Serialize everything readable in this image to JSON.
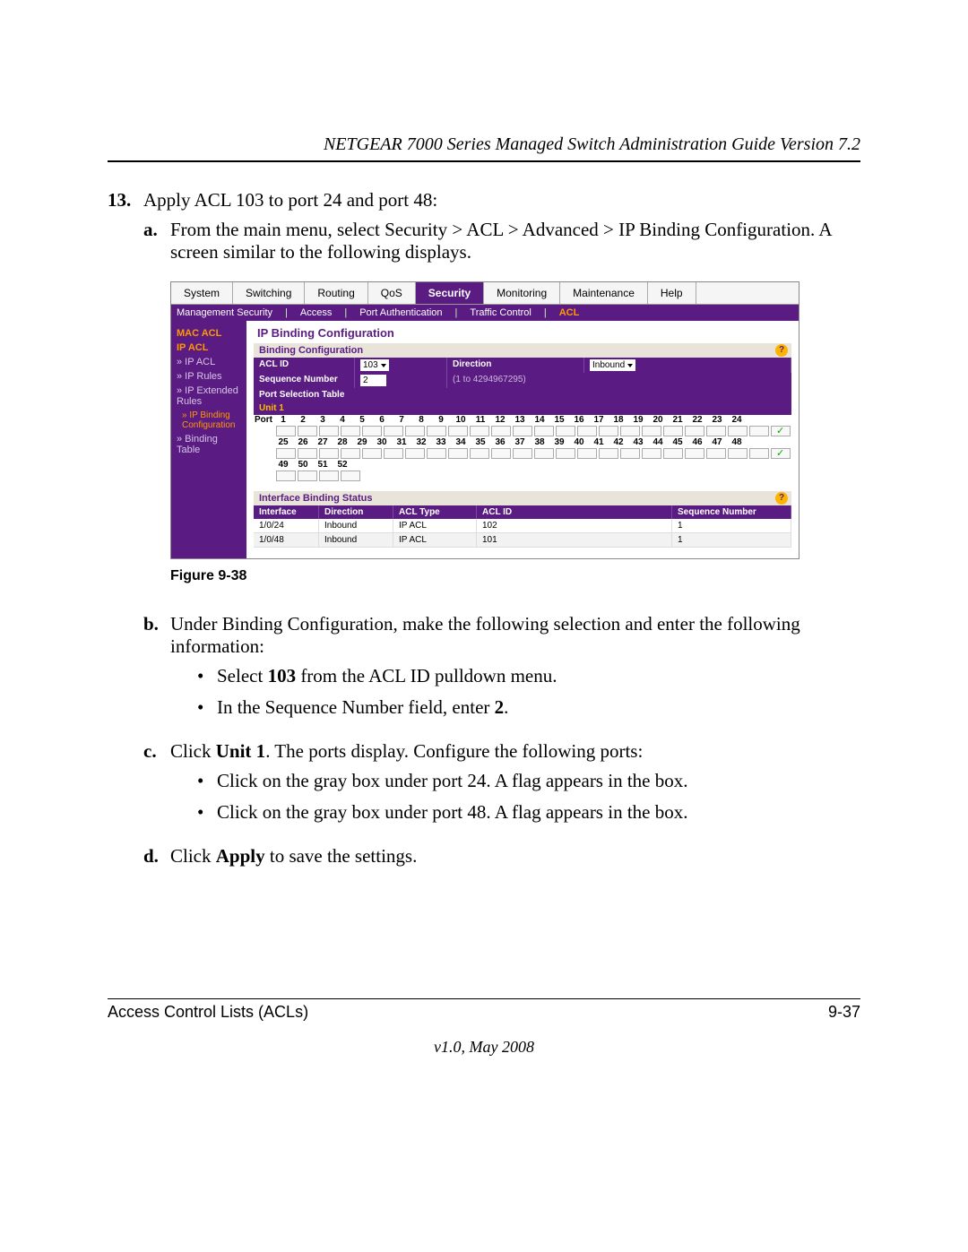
{
  "header": {
    "title": "NETGEAR 7000 Series Managed Switch Administration Guide Version 7.2"
  },
  "step13": {
    "number": "13.",
    "text": "Apply ACL 103 to port 24 and port 48:",
    "a": {
      "letter": "a.",
      "text": "From the main menu, select Security > ACL > Advanced > IP Binding Configuration. A screen similar to the following displays."
    },
    "b": {
      "letter": "b.",
      "text": "Under Binding Configuration, make the following selection and enter the following information:",
      "bullet1_pre": "Select ",
      "bullet1_bold": "103",
      "bullet1_post": " from the ACL ID pulldown menu.",
      "bullet2_pre": "In the Sequence Number field, enter ",
      "bullet2_bold": "2",
      "bullet2_post": "."
    },
    "c": {
      "letter": "c.",
      "pre": "Click ",
      "bold": "Unit 1",
      "post": ". The ports display. Configure the following ports:",
      "bullet1": "Click on the gray box under port 24. A flag appears in the box.",
      "bullet2": "Click on the gray box under port 48. A flag appears in the box."
    },
    "d": {
      "letter": "d.",
      "pre": "Click ",
      "bold": "Apply",
      "post": " to save the settings."
    }
  },
  "screenshot": {
    "tabs": [
      "System",
      "Switching",
      "Routing",
      "QoS",
      "Security",
      "Monitoring",
      "Maintenance",
      "Help"
    ],
    "active_tab": "Security",
    "subtabs": {
      "items": [
        "Management Security",
        "Access",
        "Port Authentication",
        "Traffic Control"
      ],
      "active": "ACL"
    },
    "sidebar": {
      "mac_acl": "MAC ACL",
      "ip_acl_head": "IP ACL",
      "ip_acl": "» IP ACL",
      "ip_rules": "» IP Rules",
      "ip_ext": "» IP Extended Rules",
      "ip_binding": "» IP Binding Configuration",
      "binding_table": "» Binding Table"
    },
    "main": {
      "title": "IP Binding Configuration",
      "binding_conf": "Binding Configuration",
      "acl_id_label": "ACL ID",
      "acl_id_value": "103",
      "direction_label": "Direction",
      "direction_value": "Inbound",
      "seq_label": "Sequence Number",
      "seq_value": "2",
      "seq_hint": "(1 to 4294967295)",
      "port_sel": "Port Selection Table",
      "unit": "Unit 1",
      "ports_row1": [
        "Port",
        "1",
        "2",
        "3",
        "4",
        "5",
        "6",
        "7",
        "8",
        "9",
        "10",
        "11",
        "12",
        "13",
        "14",
        "15",
        "16",
        "17",
        "18",
        "19",
        "20",
        "21",
        "22",
        "23",
        "24"
      ],
      "ports_row2": [
        "",
        "25",
        "26",
        "27",
        "28",
        "29",
        "30",
        "31",
        "32",
        "33",
        "34",
        "35",
        "36",
        "37",
        "38",
        "39",
        "40",
        "41",
        "42",
        "43",
        "44",
        "45",
        "46",
        "47",
        "48"
      ],
      "ports_row3": [
        "",
        "49",
        "50",
        "51",
        "52",
        "",
        "",
        "",
        "",
        "",
        "",
        "",
        "",
        "",
        "",
        "",
        "",
        "",
        "",
        "",
        "",
        "",
        "",
        "",
        ""
      ],
      "ibs_title": "Interface Binding Status",
      "ibs_headers": [
        "Interface",
        "Direction",
        "ACL Type",
        "ACL ID",
        "Sequence Number"
      ],
      "ibs_rows": [
        {
          "if": "1/0/24",
          "dir": "Inbound",
          "type": "IP ACL",
          "aclid": "102",
          "seq": "1"
        },
        {
          "if": "1/0/48",
          "dir": "Inbound",
          "type": "IP ACL",
          "aclid": "101",
          "seq": "1"
        }
      ]
    }
  },
  "figure_caption": "Figure 9-38",
  "footer": {
    "left": "Access Control Lists (ACLs)",
    "right": "9-37",
    "version": "v1.0, May 2008"
  }
}
